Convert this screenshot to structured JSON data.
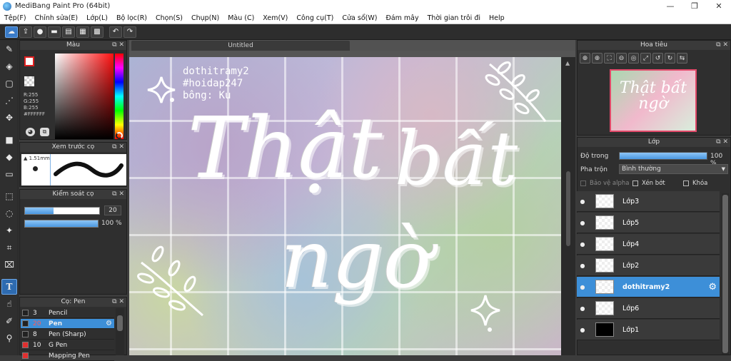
{
  "window": {
    "title": "MediBang Paint Pro (64bit)",
    "min": "—",
    "max": "❐",
    "close": "✕"
  },
  "menu": [
    "Tệp(F)",
    "Chỉnh sửa(E)",
    "Lớp(L)",
    "Bộ lọc(R)",
    "Chọn(S)",
    "Chụp(N)",
    "Màu (C)",
    "Xem(V)",
    "Công cụ(T)",
    "Cửa sổ(W)",
    "Đám mây",
    "Thời gian trôi đi",
    "Help"
  ],
  "toolbar": {
    "icons": [
      "cloud-icon",
      "share-icon",
      "chat-icon",
      "comment-icon",
      "page-icon",
      "page-list-icon",
      "grid-icon",
      "undo-icon",
      "redo-icon"
    ]
  },
  "color_panel": {
    "title": "Màu",
    "r": "R:255",
    "g": "G:255",
    "b": "B:255",
    "hex": "#FFFFFF",
    "fg": "#ffffff",
    "bg": "#ffffff"
  },
  "brush_preview": {
    "title": "Xem trước cọ",
    "size": "1.51mm"
  },
  "brush_control": {
    "title": "Kiểm soát cọ",
    "size_value": "20",
    "size_fraction": 0.38,
    "opacity_value": "100 %",
    "opacity_fraction": 1.0
  },
  "brush_list": {
    "title": "Cọ: Pen",
    "items": [
      {
        "size": "3",
        "name": "Pencil",
        "color": "#222222",
        "selected": false
      },
      {
        "size": "20",
        "name": "Pen",
        "color": "#222222",
        "selected": true
      },
      {
        "size": "8",
        "name": "Pen (Sharp)",
        "color": "#222222",
        "selected": false
      },
      {
        "size": "10",
        "name": "G Pen",
        "color": "#e03030",
        "selected": false
      },
      {
        "size": "",
        "name": "Mapping Pen",
        "color": "#e03030",
        "selected": false
      }
    ]
  },
  "document": {
    "tab": "Untitled"
  },
  "artwork": {
    "credit_lines": [
      "dothitramy2",
      "#hoidap247",
      "bông: Ku"
    ],
    "headline_1": "Thật",
    "headline_2": "bất",
    "headline_3": "ngờ"
  },
  "navigator": {
    "title": "Hoa tiêu",
    "preview_line1": "Thật bất",
    "preview_line2": "ngờ"
  },
  "layers": {
    "title": "Lớp",
    "opacity_label": "Độ trong",
    "opacity_value": "100 %",
    "opacity_fraction": 1.0,
    "blend_label": "Pha trộn",
    "blend_value": "Bình thường",
    "protect_alpha": "Bảo vệ alpha",
    "clipping": "Xén bớt",
    "lock": "Khóa",
    "items": [
      {
        "name": "Lớp3",
        "selected": false
      },
      {
        "name": "Lớp5",
        "selected": false
      },
      {
        "name": "Lớp4",
        "selected": false
      },
      {
        "name": "Lớp2",
        "selected": false
      },
      {
        "name": "dothitramy2",
        "selected": true
      },
      {
        "name": "Lớp6",
        "selected": false
      },
      {
        "name": "Lớp1",
        "selected": false
      }
    ]
  }
}
